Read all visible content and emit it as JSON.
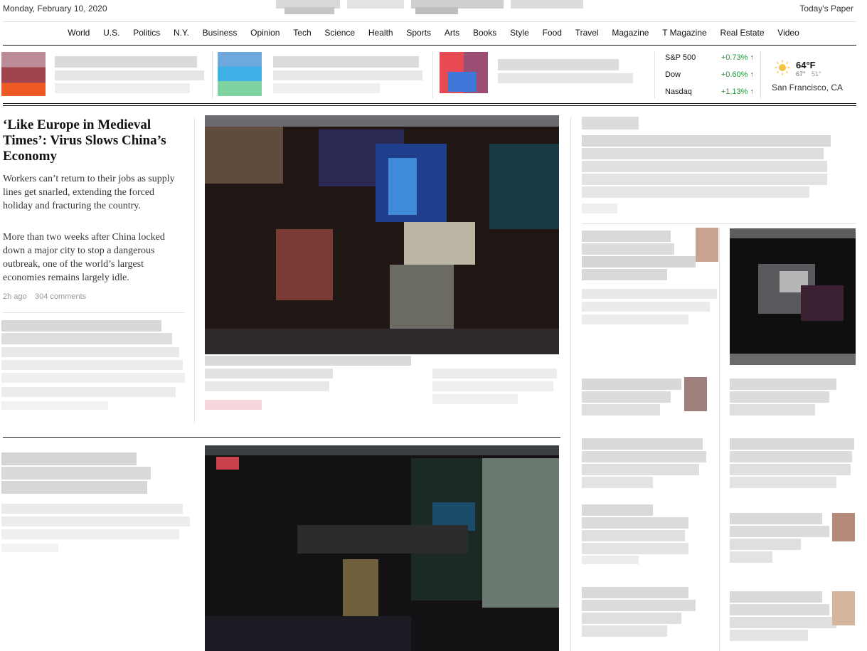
{
  "header": {
    "date": "Monday, February 10, 2020",
    "todays_paper": "Today's Paper"
  },
  "nav": [
    "World",
    "U.S.",
    "Politics",
    "N.Y.",
    "Business",
    "Opinion",
    "Tech",
    "Science",
    "Health",
    "Sports",
    "Arts",
    "Books",
    "Style",
    "Food",
    "Travel",
    "Magazine",
    "T Magazine",
    "Real Estate",
    "Video"
  ],
  "markets": [
    {
      "name": "S&P 500",
      "change": "+0.73%",
      "arrow": "↑"
    },
    {
      "name": "Dow",
      "change": "+0.60%",
      "arrow": "↑"
    },
    {
      "name": "Nasdaq",
      "change": "+1.13%",
      "arrow": "↑"
    }
  ],
  "weather": {
    "temp": "64°F",
    "hi": "67°",
    "lo": "51°",
    "city": "San Francisco, CA",
    "icon": "sun-icon"
  },
  "lead_story": {
    "headline": "‘Like Europe in Medieval Times’: Virus Slows China’s Economy",
    "summary1": "Workers can’t return to their jobs as supply lines get snarled, extending the forced holiday and fracturing the country.",
    "summary2": "More than two weeks after China locked down a major city to stop a dangerous outbreak, one of the world’s largest economies remains largely idle.",
    "time": "2h ago",
    "comments": "304 comments"
  },
  "colors": {
    "market_up": "#2a8f3e",
    "rule": "#121212",
    "blur_light": "#e8e8e8",
    "blur_mid": "#d6d6d6"
  }
}
